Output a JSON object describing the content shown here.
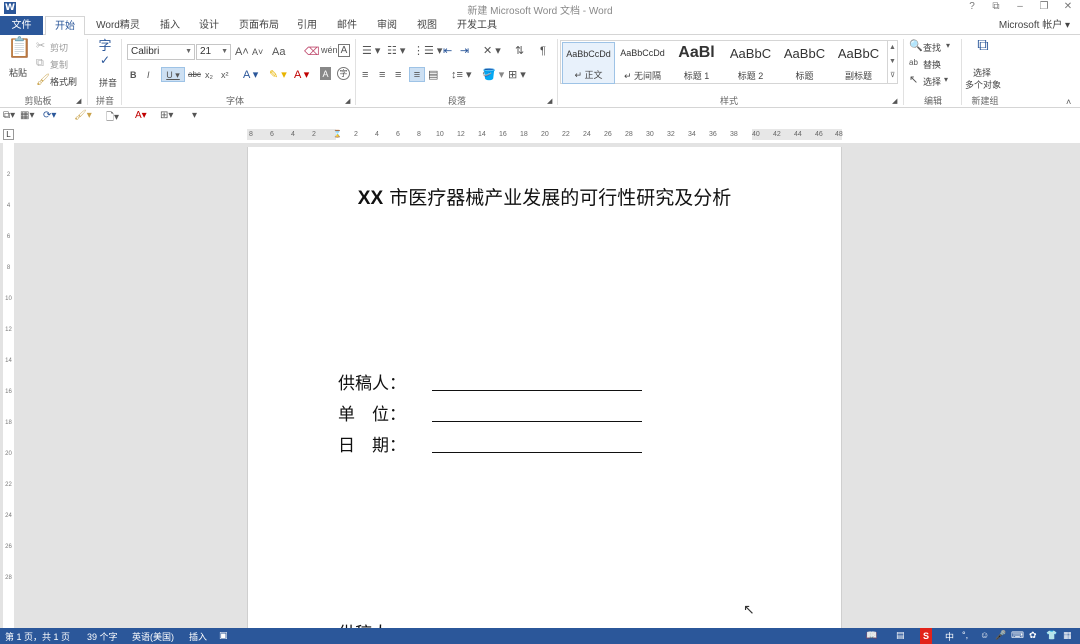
{
  "window": {
    "title": "新建 Microsoft Word 文档 - Word",
    "controls": [
      "?",
      "⧉",
      "–",
      "❐",
      "✕"
    ]
  },
  "tabs": {
    "file": "文件",
    "items": [
      "开始",
      "Word精灵",
      "插入",
      "设计",
      "页面布局",
      "引用",
      "邮件",
      "审阅",
      "视图",
      "开发工具"
    ],
    "account": "Microsoft 帐户 ▾"
  },
  "ribbon": {
    "clipboard": {
      "paste": "粘贴",
      "cut": "剪切",
      "copy": "复制",
      "format_painter": "格式刷",
      "label": "剪贴板"
    },
    "pinyin": {
      "button": "拼音",
      "label": "拼音"
    },
    "font": {
      "name": "Calibri",
      "size": "21",
      "label": "字体"
    },
    "paragraph": {
      "label": "段落"
    },
    "styles": {
      "label": "样式",
      "items": [
        {
          "sample": "AaBbCcDd",
          "name": "↵ 正文"
        },
        {
          "sample": "AaBbCcDd",
          "name": "↵ 无间隔"
        },
        {
          "sample": "AaBl",
          "name": "标题 1"
        },
        {
          "sample": "AaBbC",
          "name": "标题 2"
        },
        {
          "sample": "AaBbC",
          "name": "标题"
        },
        {
          "sample": "AaBbC",
          "name": "副标题"
        }
      ]
    },
    "editing": {
      "find": "查找",
      "replace": "替换",
      "select": "选择",
      "label": "编辑"
    },
    "newgroup": {
      "button_line1": "选择",
      "button_line2": "多个对象",
      "label": "新建组"
    }
  },
  "ruler": {
    "h_ticks": [
      "8",
      "6",
      "4",
      "2",
      "",
      "2",
      "4",
      "6",
      "8",
      "10",
      "12",
      "14",
      "16",
      "18",
      "20",
      "22",
      "24",
      "26",
      "28",
      "30",
      "32",
      "34",
      "36",
      "38",
      "40",
      "42",
      "44",
      "46",
      "48"
    ],
    "v_ticks": [
      "2",
      "4",
      "6",
      "8",
      "10",
      "12",
      "14",
      "16",
      "18",
      "20",
      "22",
      "24",
      "26",
      "28"
    ]
  },
  "document": {
    "title_prefix": "XX",
    "title_rest": " 市医疗器械产业发展的可行性研究及分析",
    "fields": [
      {
        "label": "供稿人："
      },
      {
        "label": "单　位："
      },
      {
        "label": "日　期："
      }
    ],
    "cut_text": "供稿人"
  },
  "status": {
    "page": "第 1 页，共 1 页",
    "words": "39 个字",
    "language": "英语(美国)",
    "mode": "插入"
  },
  "colors": {
    "accent": "#2b579a"
  }
}
